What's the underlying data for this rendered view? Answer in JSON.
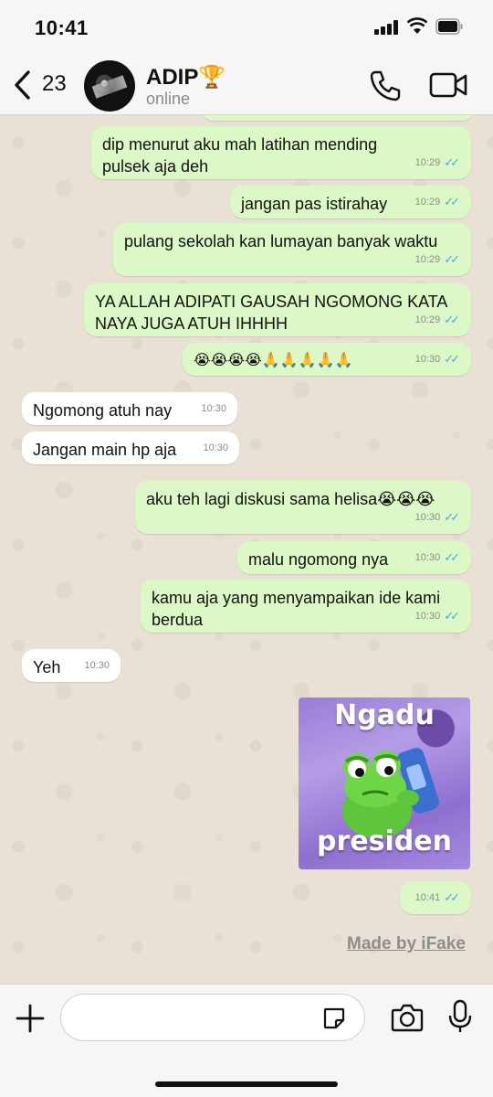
{
  "status_bar": {
    "time": "10:41"
  },
  "header": {
    "back_count": "23",
    "contact_name": "ADIP🏆",
    "contact_status": "online"
  },
  "messages": [
    {
      "dir": "out",
      "text": "dip menurut aku mah latihan mending pulsek aja deh",
      "time": "10:29"
    },
    {
      "dir": "out",
      "text": "jangan pas istirahay",
      "time": "10:29"
    },
    {
      "dir": "out",
      "text": "pulang sekolah kan lumayan banyak waktu",
      "time": "10:29"
    },
    {
      "dir": "out",
      "text": "YA ALLAH ADIPATI GAUSAH NGOMONG KATA NAYA JUGA ATUH IHHHH",
      "time": "10:29"
    },
    {
      "dir": "out",
      "text": "😭😭😭😭🙏🙏🙏🙏🙏",
      "time": "10:30"
    },
    {
      "dir": "in",
      "text": "Ngomong atuh nay",
      "time": "10:30"
    },
    {
      "dir": "in",
      "text": "Jangan main hp aja",
      "time": "10:30"
    },
    {
      "dir": "out",
      "text": "aku teh lagi diskusi sama helisa😭😭😭",
      "time": "10:30"
    },
    {
      "dir": "out",
      "text": "malu ngomong nya",
      "time": "10:30"
    },
    {
      "dir": "out",
      "text": "kamu aja yang menyampaikan ide kami berdua",
      "time": "10:30"
    },
    {
      "dir": "in",
      "text": "Yeh",
      "time": "10:30"
    },
    {
      "dir": "out",
      "text": "",
      "time": "10:41"
    }
  ],
  "sticker": {
    "top_text": "Ngadu",
    "bottom_text": "presiden"
  },
  "watermark": "Made by iFake",
  "input": {
    "placeholder": ""
  },
  "colors": {
    "outgoing": "#dcf8c6",
    "incoming": "#ffffff",
    "ticks": "#4fa6e6",
    "background": "#e9e1d6"
  },
  "icons": [
    "back-chevron-icon",
    "phone-icon",
    "video-icon",
    "plus-icon",
    "sticker-icon",
    "camera-icon",
    "microphone-icon"
  ]
}
